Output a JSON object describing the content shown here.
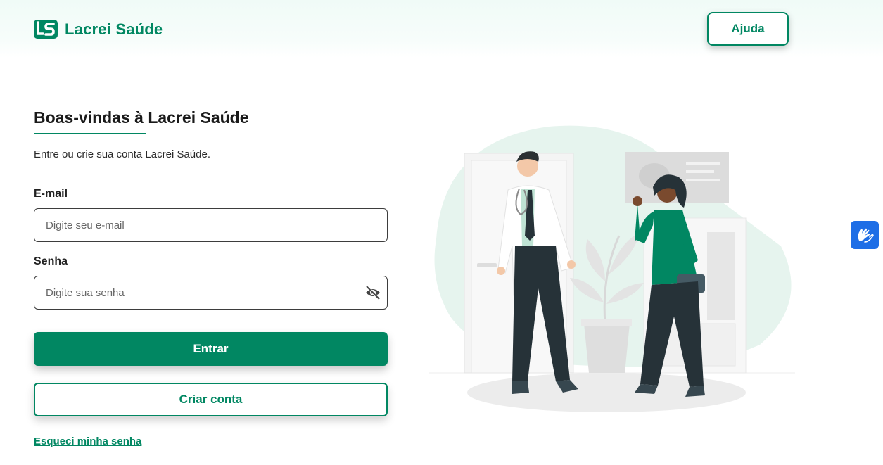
{
  "header": {
    "brand": "Lacrei Saúde",
    "help_label": "Ajuda"
  },
  "login": {
    "title": "Boas-vindas à Lacrei Saúde",
    "subtitle": "Entre ou crie sua conta Lacrei Saúde.",
    "email": {
      "label": "E-mail",
      "placeholder": "Digite seu e-mail",
      "value": ""
    },
    "password": {
      "label": "Senha",
      "placeholder": "Digite sua senha",
      "value": ""
    },
    "enter_label": "Entrar",
    "create_label": "Criar conta",
    "forgot_label": "Esqueci minha senha"
  },
  "icons": {
    "logo": "lacrei-logo-icon",
    "password_toggle": "eye-off-icon",
    "accessibility": "sign-language-hands-icon"
  },
  "colors": {
    "brand": "#018762",
    "accessibility": "#1e6ee6",
    "illustration_bg": "#e6f4ee"
  }
}
